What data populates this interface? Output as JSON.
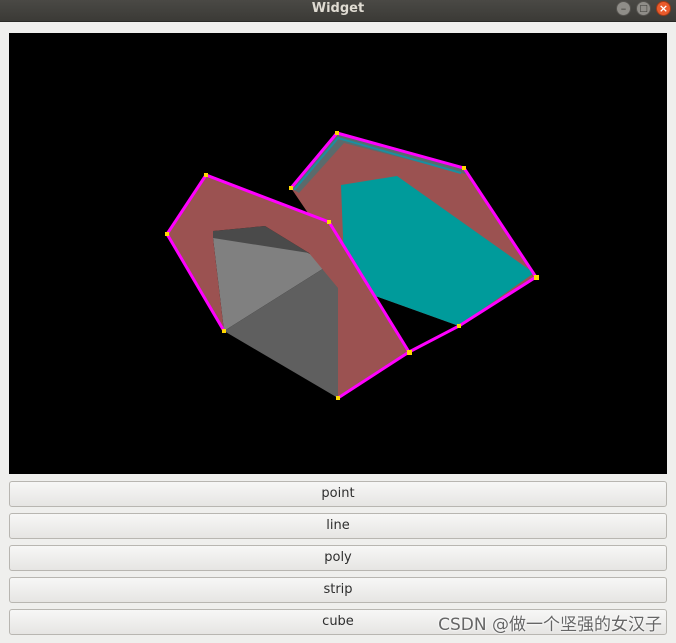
{
  "window": {
    "title": "Widget",
    "minimize_glyph": "–",
    "maximize_glyph": "□",
    "close_glyph": "×"
  },
  "viewport": {
    "background": "#000000",
    "colors": {
      "red_polygon": "#9b5251",
      "teal_polygon": "#009b9b",
      "gray_light": "#808080",
      "gray_dark": "#5f5f5f",
      "outline": "#ff00ff",
      "vertex": "#ffd700"
    }
  },
  "buttons": [
    {
      "label": "point"
    },
    {
      "label": "line"
    },
    {
      "label": "poly"
    },
    {
      "label": "strip"
    },
    {
      "label": "cube"
    }
  ],
  "watermark": "CSDN @做一个坚强的女汉子"
}
